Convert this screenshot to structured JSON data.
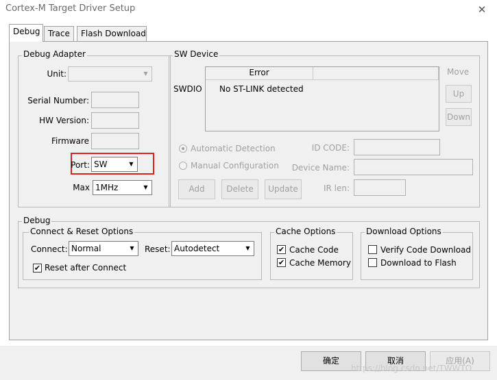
{
  "window": {
    "title": "Cortex-M Target Driver Setup",
    "close_label": "✕"
  },
  "tabs": [
    {
      "label": "Debug",
      "active": true
    },
    {
      "label": "Trace",
      "active": false
    },
    {
      "label": "Flash Download",
      "active": false
    }
  ],
  "debug_adapter": {
    "legend": "Debug Adapter",
    "unit_label": "Unit:",
    "unit_value": "",
    "serial_label": "Serial Number:",
    "serial_value": "",
    "hw_label": "HW Version:",
    "hw_value": "",
    "firmware_label": "Firmware",
    "firmware_value": "",
    "port_label": "Port:",
    "port_value": "SW",
    "max_label": "Max",
    "max_value": "1MHz"
  },
  "sw_device": {
    "legend": "SW Device",
    "row_label": "SWDIO",
    "columns": [
      "Error",
      ""
    ],
    "message": "No ST-LINK detected",
    "move_label": "Move",
    "up_label": "Up",
    "down_label": "Down",
    "auto_detect_label": "Automatic Detection",
    "manual_config_label": "Manual Configuration",
    "id_code_label": "ID CODE:",
    "device_name_label": "Device Name:",
    "ir_len_label": "IR len:",
    "add_label": "Add",
    "delete_label": "Delete",
    "update_label": "Update"
  },
  "debug": {
    "legend": "Debug",
    "connect_reset": {
      "legend": "Connect & Reset Options",
      "connect_label": "Connect:",
      "connect_value": "Normal",
      "reset_label": "Reset:",
      "reset_value": "Autodetect",
      "reset_after_connect_label": "Reset after Connect",
      "reset_after_connect_checked": true
    },
    "cache": {
      "legend": "Cache Options",
      "cache_code_label": "Cache Code",
      "cache_code_checked": true,
      "cache_memory_label": "Cache Memory",
      "cache_memory_checked": true
    },
    "download": {
      "legend": "Download Options",
      "verify_label": "Verify Code Download",
      "verify_checked": false,
      "flash_label": "Download to Flash",
      "flash_checked": false
    }
  },
  "footer": {
    "ok_label": "确定",
    "cancel_label": "取消",
    "apply_label": "应用(A)",
    "watermark": "https://blog.csdn.net/TWWTO"
  },
  "icons": {
    "check": "✔",
    "dropdown": "▼"
  }
}
